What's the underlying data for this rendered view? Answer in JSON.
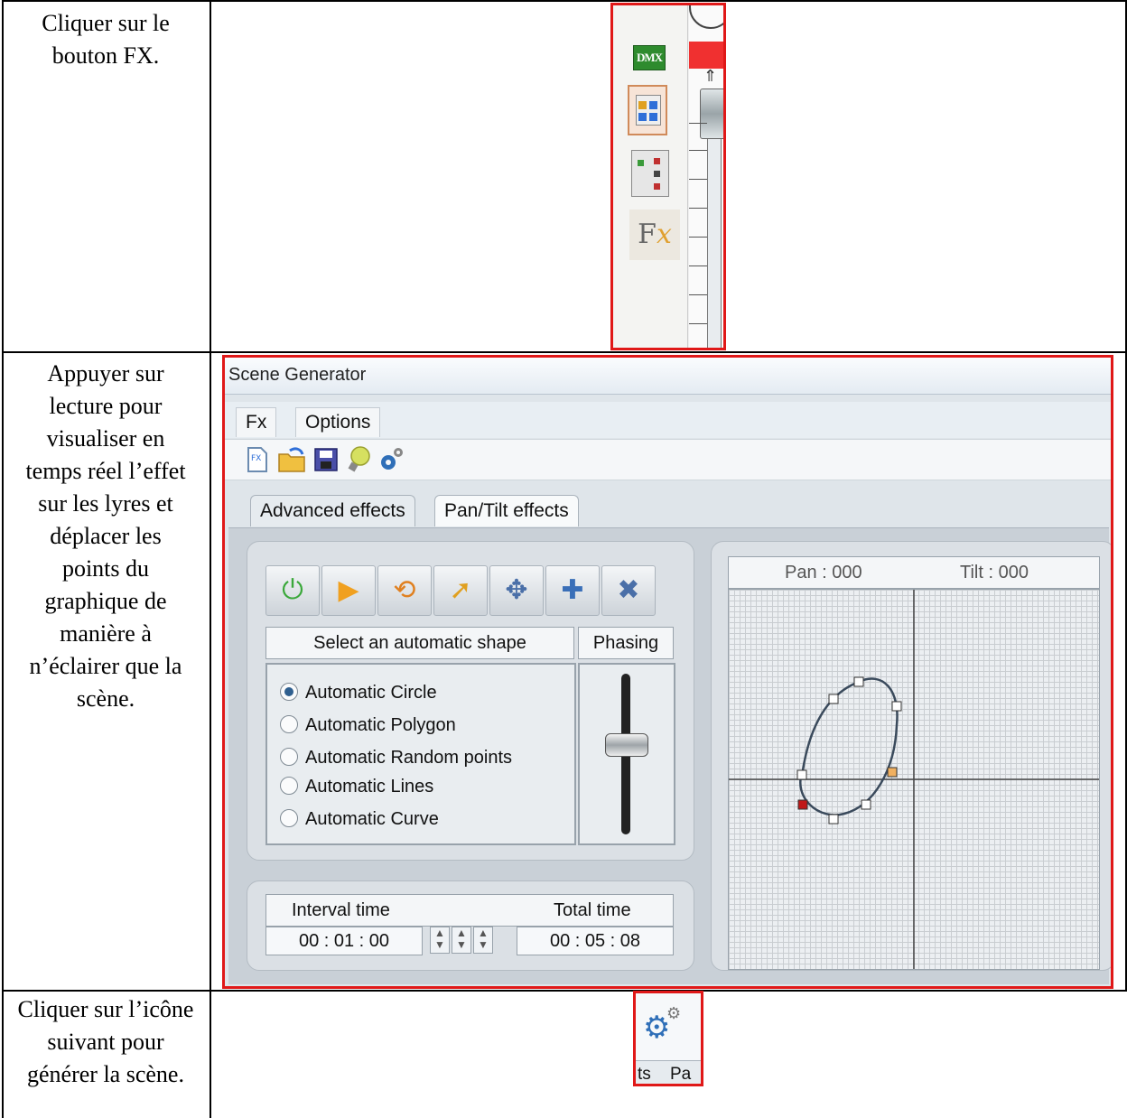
{
  "steps": [
    {
      "text": "Cliquer sur le bouton FX."
    },
    {
      "text": "Appuyer sur lecture pour visualiser en temps réel l’effet sur les lyres et déplacer les points du graphique de manière à n’éclairer que la scène."
    },
    {
      "text": "Cliquer sur l’icône suivant pour générer la scène."
    }
  ],
  "crop1": {
    "dmx_label": "DMX",
    "fx_label": "Fx",
    "icons": [
      "dmx-icon",
      "scene-grid-icon",
      "panel-icon",
      "fx-icon"
    ]
  },
  "scene_window": {
    "title": "Scene Generator",
    "menu": [
      "Fx",
      "Options"
    ],
    "toolbar_icons": [
      "new-file-icon",
      "open-folder-icon",
      "save-icon",
      "lightbulb-icon",
      "generate-gears-icon"
    ],
    "tabs": [
      "Advanced effects",
      "Pan/Tilt effects"
    ],
    "active_tab": "Pan/Tilt effects",
    "control_buttons": [
      "power-icon",
      "play-icon",
      "loop-icon",
      "cursor-icon",
      "move-icon",
      "add-point-icon",
      "delete-point-icon"
    ],
    "shape_header": "Select an automatic shape",
    "phasing_header": "Phasing",
    "shapes": [
      "Automatic Circle",
      "Automatic Polygon",
      "Automatic Random points",
      "Automatic Lines",
      "Automatic Curve"
    ],
    "selected_shape": "Automatic Circle",
    "interval_label": "Interval time",
    "total_label": "Total time",
    "interval_value": "00 : 01 : 00",
    "total_value": "00 : 05 : 08",
    "pan_label": "Pan : 000",
    "tilt_label": "Tilt : 000"
  },
  "crop3": {
    "tab_fragment_left": "ts",
    "tab_fragment_right": "Pa",
    "icon": "generate-gears-icon"
  },
  "colors": {
    "highlight_border": "#e01818",
    "point_selected": "#c01818",
    "point_active": "#f0b060"
  }
}
